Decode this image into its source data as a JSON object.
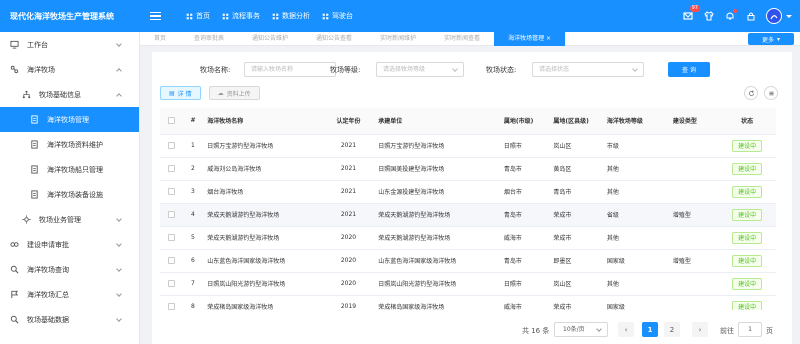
{
  "header": {
    "app_title": "现代化海洋牧场生产管理系统",
    "nav": [
      {
        "label": "首页",
        "icon": "home-icon"
      },
      {
        "label": "流程事务",
        "icon": "flow-icon"
      },
      {
        "label": "数据分析",
        "icon": "chart-icon"
      },
      {
        "label": "驾驶台",
        "icon": "dashboard-icon"
      }
    ],
    "message_badge": "97"
  },
  "sidebar": {
    "items": [
      {
        "label": "工作台",
        "icon": "monitor-icon",
        "level": 1,
        "expand": "down"
      },
      {
        "label": "海洋牧场",
        "icon": "settings-icon",
        "level": 1,
        "expand": "up"
      },
      {
        "label": "牧场基础信息",
        "icon": "cluster-icon",
        "level": 2,
        "expand": "up"
      },
      {
        "label": "海洋牧场管理",
        "icon": "doc-icon",
        "level": 3,
        "active": true
      },
      {
        "label": "海洋牧场资料维护",
        "icon": "doc-icon",
        "level": 3
      },
      {
        "label": "海洋牧场船只管理",
        "icon": "doc-icon",
        "level": 3
      },
      {
        "label": "海洋牧场装备设施",
        "icon": "doc-icon",
        "level": 3
      },
      {
        "label": "牧场业务管理",
        "icon": "gear-icon",
        "level": 2,
        "expand": "down"
      },
      {
        "label": "建设申请审批",
        "icon": "link-icon",
        "level": 1,
        "expand": "down"
      },
      {
        "label": "海洋牧场查询",
        "icon": "search-icon",
        "level": 1,
        "expand": "down"
      },
      {
        "label": "海洋牧场汇总",
        "icon": "flag-icon",
        "level": 1,
        "expand": "down"
      },
      {
        "label": "牧场基础数据",
        "icon": "search-icon",
        "level": 1,
        "expand": "down"
      }
    ]
  },
  "tabs": {
    "items": [
      "首页",
      "查询审批表",
      "通知公告维护",
      "通知公告查看",
      "实时新闻维护",
      "实时新闻查看",
      "海洋牧场管理"
    ],
    "active_index": 6,
    "more_label": "更多"
  },
  "filters": {
    "name_label": "牧场名称:",
    "name_placeholder": "请输入牧场名称",
    "level_label": "牧场等级:",
    "level_placeholder": "请选择牧场等级",
    "status_label": "牧场状态:",
    "status_placeholder": "请选择状态",
    "search_label": "查 询"
  },
  "actions": {
    "detail_label": "详 情",
    "upload_label": "资料上传"
  },
  "table": {
    "headers": [
      "#",
      "海洋牧场名称",
      "认定年份",
      "承建单位",
      "属地(市级)",
      "属地(区县级)",
      "海洋牧场等级",
      "建设类型",
      "状态"
    ],
    "rows": [
      [
        "1",
        "日照万宝游钓型海洋牧场",
        "2021",
        "日照万宝游钓型海洋牧场",
        "日照市",
        "岚山区",
        "市级",
        "",
        "建设中"
      ],
      [
        "2",
        "威海刘公岛海洋牧场",
        "2021",
        "日照国美投建型海洋牧场",
        "青岛市",
        "黄岛区",
        "其他",
        "",
        "建设中"
      ],
      [
        "3",
        "烟台海洋牧场",
        "2021",
        "山东金源投建型海洋牧场",
        "烟台市",
        "青岛市",
        "其他",
        "",
        "建设中"
      ],
      [
        "4",
        "荣成天鹅湖游钓型海洋牧场",
        "2021",
        "荣成天鹅湖游钓型海洋牧场",
        "青岛市",
        "荣成市",
        "省级",
        "增殖型",
        "建设中"
      ],
      [
        "5",
        "荣成天鹅湖游钓型海洋牧场",
        "2020",
        "荣成天鹅湖游钓型海洋牧场",
        "威海市",
        "荣成市",
        "其他",
        "",
        "建设中"
      ],
      [
        "6",
        "山东蓝色海洋国家级海洋牧场",
        "2020",
        "山东蓝色海洋国家级海洋牧场",
        "青岛市",
        "即墨区",
        "国家级",
        "增殖型",
        "建设中"
      ],
      [
        "7",
        "日照岚山阳光游钓型海洋牧场",
        "2020",
        "日照岚山阳光游钓型海洋牧场",
        "日照市",
        "岚山区",
        "其他",
        "",
        "建设中"
      ],
      [
        "8",
        "荣成楮岛国家级海洋牧场",
        "2019",
        "荣成楮岛国家级海洋牧场",
        "威海市",
        "荣成市",
        "国家级",
        "",
        "建设中"
      ]
    ],
    "highlight_row": 3
  },
  "pagination": {
    "total": "共 16 条",
    "page_size": "10条/页",
    "pages": [
      "1",
      "2"
    ],
    "current": "1",
    "goto_label": "前往",
    "goto_value": "1",
    "goto_unit": "页"
  },
  "colors": {
    "primary": "#1890ff",
    "success": "#52c41a"
  }
}
